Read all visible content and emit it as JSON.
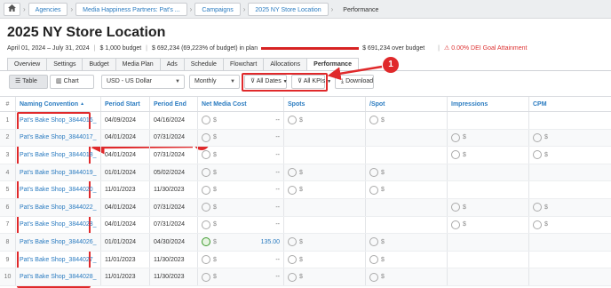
{
  "breadcrumb": [
    "Agencies",
    "Media Happiness Partners: Pat's ...",
    "Campaigns",
    "2025 NY Store Location",
    "Performance"
  ],
  "page_title": "2025 NY Store Location",
  "meta": {
    "dates": "April 01, 2024 – July 31, 2024",
    "budget": "$ 1,000 budget",
    "in_plan": "$ 692,234 (69,223% of budget) in plan",
    "over_budget": "$ 691,234 over budget",
    "dei": "0.00% DEI Goal Attainment"
  },
  "tabs": [
    "Overview",
    "Settings",
    "Budget",
    "Media Plan",
    "Ads",
    "Schedule",
    "Flowchart",
    "Allocations",
    "Performance"
  ],
  "toolbar": {
    "table_label": "Table",
    "chart_label": "Chart",
    "currency": "USD - US Dollar",
    "period": "Monthly",
    "dates_filter": "All Dates",
    "kpi_filter": "All KPIs",
    "download_label": "Download"
  },
  "annotations": [
    "1",
    "2"
  ],
  "columns": [
    "#",
    "Naming Convention",
    "Period Start",
    "Period End",
    "Net Media Cost",
    "Spots",
    "/Spot",
    "Impressions",
    "CPM"
  ],
  "rows": [
    {
      "n": "1",
      "name": "Pat's Bake Shop_3844016_",
      "start": "04/09/2024",
      "end": "04/16/2024",
      "cost": "--",
      "good": false,
      "spots": true,
      "perspot": true,
      "impr": false,
      "cpm": false
    },
    {
      "n": "2",
      "name": "Pat's Bake Shop_3844017_",
      "start": "04/01/2024",
      "end": "07/31/2024",
      "cost": "--",
      "good": false,
      "spots": false,
      "perspot": false,
      "impr": true,
      "cpm": true
    },
    {
      "n": "3",
      "name": "Pat's Bake Shop_3844018_",
      "start": "04/01/2024",
      "end": "07/31/2024",
      "cost": "--",
      "good": false,
      "spots": false,
      "perspot": false,
      "impr": true,
      "cpm": true
    },
    {
      "n": "4",
      "name": "Pat's Bake Shop_3844019_",
      "start": "01/01/2024",
      "end": "05/02/2024",
      "cost": "--",
      "good": false,
      "spots": true,
      "perspot": true,
      "impr": false,
      "cpm": false
    },
    {
      "n": "5",
      "name": "Pat's Bake Shop_3844020_",
      "start": "11/01/2023",
      "end": "11/30/2023",
      "cost": "--",
      "good": false,
      "spots": true,
      "perspot": true,
      "impr": false,
      "cpm": false
    },
    {
      "n": "6",
      "name": "Pat's Bake Shop_3844022_",
      "start": "04/01/2024",
      "end": "07/31/2024",
      "cost": "--",
      "good": false,
      "spots": false,
      "perspot": false,
      "impr": true,
      "cpm": true
    },
    {
      "n": "7",
      "name": "Pat's Bake Shop_3844023_",
      "start": "04/01/2024",
      "end": "07/31/2024",
      "cost": "--",
      "good": false,
      "spots": false,
      "perspot": false,
      "impr": true,
      "cpm": true
    },
    {
      "n": "8",
      "name": "Pat's Bake Shop_3844026_",
      "start": "01/01/2024",
      "end": "04/30/2024",
      "cost": "135.00",
      "good": true,
      "spots": true,
      "perspot": true,
      "impr": false,
      "cpm": false
    },
    {
      "n": "9",
      "name": "Pat's Bake Shop_3844027_",
      "start": "11/01/2023",
      "end": "11/30/2023",
      "cost": "--",
      "good": false,
      "spots": true,
      "perspot": true,
      "impr": false,
      "cpm": false
    },
    {
      "n": "10",
      "name": "Pat's Bake Shop_3844028_",
      "start": "11/01/2023",
      "end": "11/30/2023",
      "cost": "--",
      "good": false,
      "spots": true,
      "perspot": true,
      "impr": false,
      "cpm": false
    }
  ],
  "colors": {
    "accent": "#2a7bc0",
    "annotation": "#e0292b"
  }
}
